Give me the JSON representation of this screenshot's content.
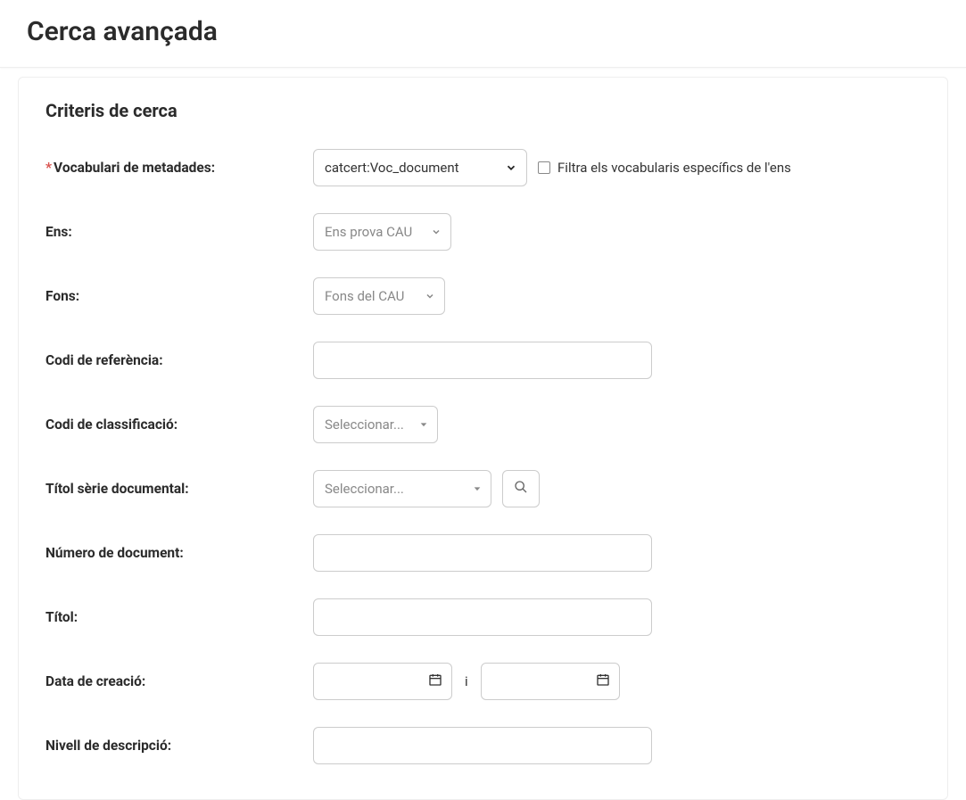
{
  "page": {
    "title": "Cerca avançada",
    "section_title": "Criteris de cerca"
  },
  "labels": {
    "vocabulari": "Vocabulari de metadades:",
    "ens": "Ens:",
    "fons": "Fons:",
    "codi_ref": "Codi de referència:",
    "codi_class": "Codi de classificació:",
    "titol_serie": "Títol sèrie documental:",
    "num_doc": "Número de document:",
    "titol": "Títol:",
    "data_creacio": "Data de creació:",
    "nivell_desc": "Nivell de descripció:"
  },
  "values": {
    "vocabulari_selected": "catcert:Voc_document",
    "ens_selected": "Ens prova CAU",
    "fons_selected": "Fons del CAU",
    "codi_class_placeholder": "Seleccionar...",
    "titol_serie_placeholder": "Seleccionar...",
    "codi_ref": "",
    "num_doc": "",
    "titol": "",
    "data_from": "",
    "data_to": "",
    "nivell_desc": ""
  },
  "checkbox": {
    "filtra_vocab_label": "Filtra els vocabularis específics de l'ens",
    "filtra_vocab_checked": false
  },
  "misc": {
    "required_mark": "*",
    "range_separator": "i"
  }
}
